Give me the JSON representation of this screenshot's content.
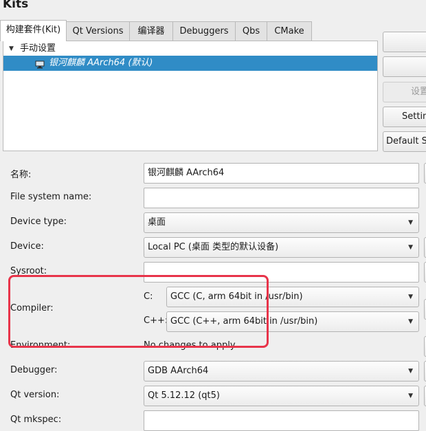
{
  "window": {
    "title": "Kits"
  },
  "tabs": [
    {
      "label": "构建套件(Kit)",
      "active": true
    },
    {
      "label": "Qt Versions"
    },
    {
      "label": "编译器"
    },
    {
      "label": "Debuggers"
    },
    {
      "label": "Qbs"
    },
    {
      "label": "CMake"
    }
  ],
  "tree": {
    "group": "手动设置",
    "kit": "银河麒麟 AArch64 (默认)"
  },
  "side_buttons": [
    {
      "label": ""
    },
    {
      "label": ""
    },
    {
      "label": "设置",
      "disabled": true
    },
    {
      "label": "Settings"
    },
    {
      "label": "Default Se"
    }
  ],
  "form": {
    "name_label": "名称:",
    "name_value": "银河麒麟 AArch64",
    "fs_label": "File system name:",
    "fs_value": "",
    "device_type_label": "Device type:",
    "device_type_value": "桌面",
    "device_label": "Device:",
    "device_value": "Local PC (桌面 类型的默认设备)",
    "sysroot_label": "Sysroot:",
    "sysroot_value": "",
    "compiler_label": "Compiler:",
    "compiler_c_label": "C:",
    "compiler_c_value": "GCC (C, arm 64bit in /usr/bin)",
    "compiler_cpp_label": "C++:",
    "compiler_cpp_value": "GCC (C++, arm 64bit in /usr/bin)",
    "environment_label": "Environment:",
    "environment_value": "No changes to apply.",
    "debugger_label": "Debugger:",
    "debugger_value": "GDB AArch64",
    "qt_version_label": "Qt version:",
    "qt_version_value": "Qt 5.12.12 (qt5)",
    "qt_mkspec_label": "Qt mkspec:",
    "qt_mkspec_value": ""
  },
  "icons": {
    "kit": "monitor-icon",
    "expand": "triangle-down-icon",
    "dropdown": "triangle-down-icon"
  },
  "colors": {
    "selection": "#308cc6",
    "annotation": "#e8344a"
  }
}
